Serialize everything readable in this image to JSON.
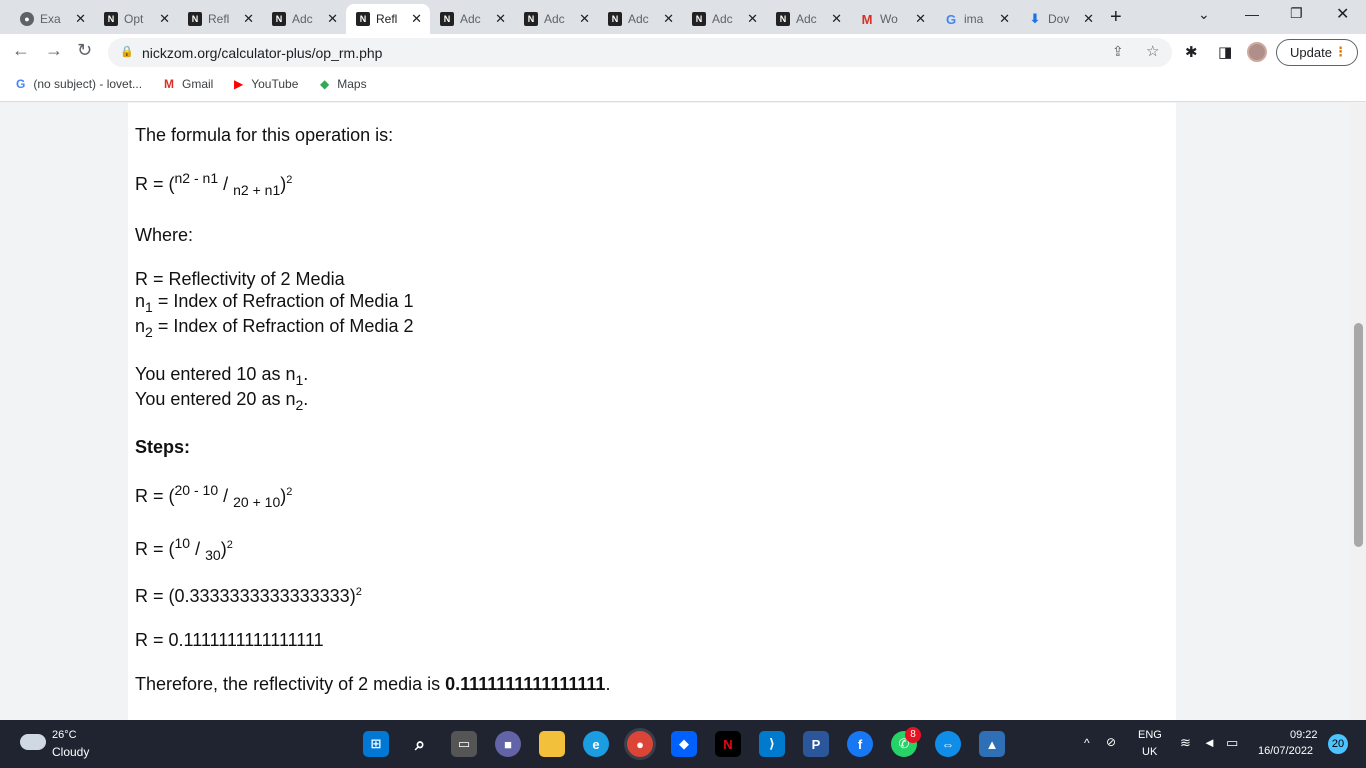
{
  "browser": {
    "tabs": [
      {
        "label": "Exa",
        "icon": "globe-icon"
      },
      {
        "label": "Opt",
        "icon": "nickzom-icon"
      },
      {
        "label": "Refl",
        "icon": "nickzom-icon"
      },
      {
        "label": "Adc",
        "icon": "nickzom-icon"
      },
      {
        "label": "Refl",
        "icon": "nickzom-icon",
        "active": true
      },
      {
        "label": "Adc",
        "icon": "nickzom-icon"
      },
      {
        "label": "Adc",
        "icon": "nickzom-icon"
      },
      {
        "label": "Adc",
        "icon": "nickzom-icon"
      },
      {
        "label": "Adc",
        "icon": "nickzom-icon"
      },
      {
        "label": "Adc",
        "icon": "nickzom-icon"
      },
      {
        "label": "Wo",
        "icon": "gmail-icon"
      },
      {
        "label": "ima",
        "icon": "google-icon"
      },
      {
        "label": "Dov",
        "icon": "download-icon"
      }
    ],
    "url": "nickzom.org/calculator-plus/op_rm.php",
    "update_label": "Update",
    "bookmarks": [
      {
        "label": "(no subject) - lovet...",
        "icon": "google-icon"
      },
      {
        "label": "Gmail",
        "icon": "gmail-icon"
      },
      {
        "label": "YouTube",
        "icon": "youtube-icon"
      },
      {
        "label": "Maps",
        "icon": "maps-icon"
      }
    ]
  },
  "content": {
    "formula_intro": "The formula for this operation is:",
    "formula": {
      "lhs": "R = (",
      "num": "n2 - n1",
      "den": "n2 + n1",
      "exp": "2"
    },
    "where_label": "Where:",
    "definitions": [
      {
        "symbol": "R",
        "sub": "",
        "text": " = Reflectivity of 2 Media"
      },
      {
        "symbol": "n",
        "sub": "1",
        "text": " = Index of Refraction of Media 1"
      },
      {
        "symbol": "n",
        "sub": "2",
        "text": " = Index of Refraction of Media 2"
      }
    ],
    "entered": [
      {
        "prefix": "You entered 10 as n",
        "sub": "1",
        "suffix": "."
      },
      {
        "prefix": "You entered 20 as n",
        "sub": "2",
        "suffix": "."
      }
    ],
    "steps_label": "Steps:",
    "step1": {
      "lhs": "R = (",
      "num": "20 - 10",
      "den": "20 + 10",
      "exp": "2"
    },
    "step2": {
      "lhs": "R = (",
      "num": "10",
      "den": "30",
      "exp": "2"
    },
    "step3": {
      "text": "R = (0.3333333333333333)",
      "exp": "2"
    },
    "step4": {
      "text": "R = 0.1111111111111111"
    },
    "conclusion": {
      "prefix": "Therefore, the reflectivity of 2 media is ",
      "value": "0.1111111111111111",
      "suffix": "."
    }
  },
  "taskbar": {
    "temperature": "26°C",
    "condition": "Cloudy",
    "language": "ENG",
    "region": "UK",
    "time": "09:22",
    "date": "16/07/2022",
    "notifications": "20",
    "whatsapp_badge": "8"
  }
}
